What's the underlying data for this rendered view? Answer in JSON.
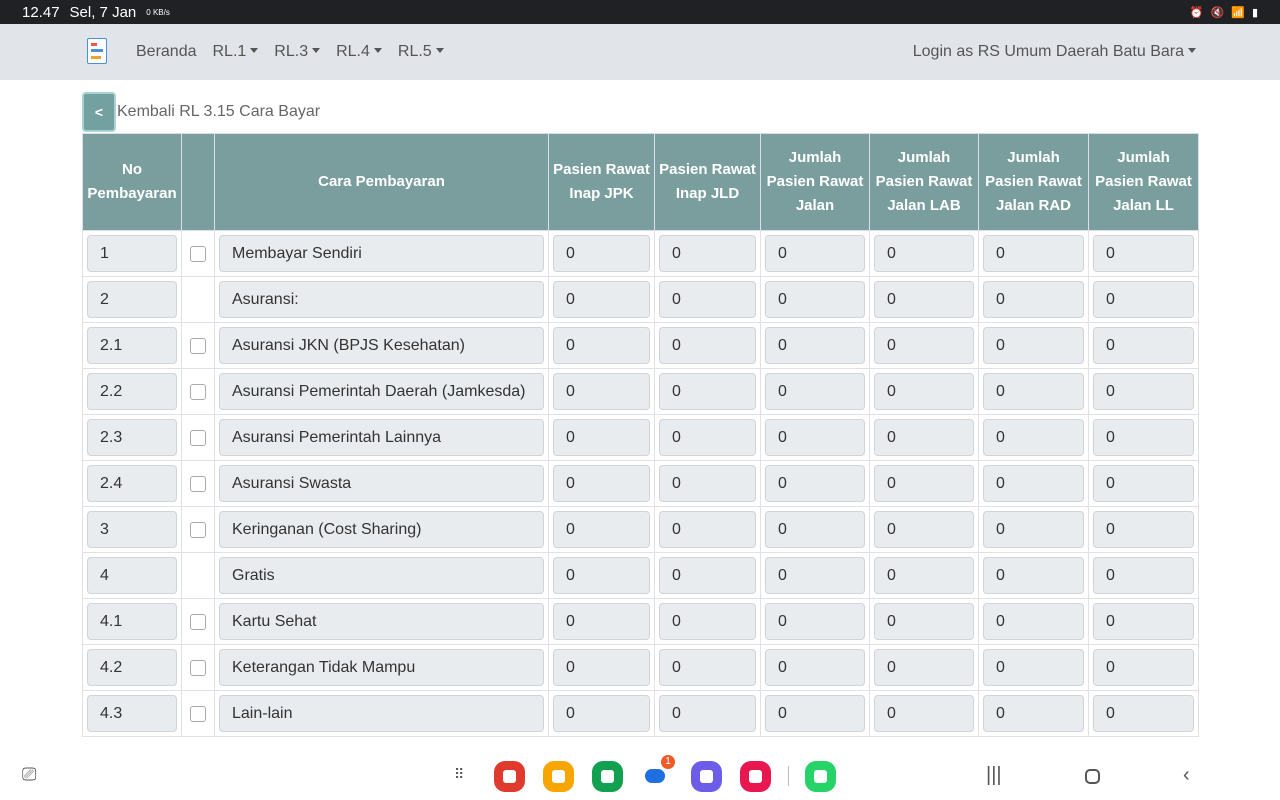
{
  "status": {
    "time": "12.47",
    "date": "Sel, 7 Jan",
    "net": "0 KB/s"
  },
  "nav": {
    "items": [
      {
        "label": "Beranda",
        "dropdown": false
      },
      {
        "label": "RL.1",
        "dropdown": true
      },
      {
        "label": "RL.3",
        "dropdown": true
      },
      {
        "label": "RL.4",
        "dropdown": true
      },
      {
        "label": "RL.5",
        "dropdown": true
      }
    ],
    "login": "Login as RS Umum Daerah Batu Bara"
  },
  "back": {
    "button": "<",
    "label": "Kembali RL 3.15 Cara Bayar"
  },
  "table": {
    "headers": [
      "No Pembayaran",
      "",
      "Cara Pembayaran",
      "Pasien Rawat Inap JPK",
      "Pasien Rawat Inap JLD",
      "Jumlah Pasien Rawat Jalan",
      "Jumlah Pasien Rawat Jalan LAB",
      "Jumlah Pasien Rawat Jalan RAD",
      "Jumlah Pasien Rawat Jalan LL"
    ],
    "rows": [
      {
        "no": "1",
        "checkbox": true,
        "cara": "Membayar Sendiri",
        "values": [
          "0",
          "0",
          "0",
          "0",
          "0",
          "0"
        ]
      },
      {
        "no": "2",
        "checkbox": false,
        "cara": "Asuransi:",
        "values": [
          "0",
          "0",
          "0",
          "0",
          "0",
          "0"
        ]
      },
      {
        "no": "2.1",
        "checkbox": true,
        "cara": "Asuransi JKN (BPJS Kesehatan)",
        "values": [
          "0",
          "0",
          "0",
          "0",
          "0",
          "0"
        ]
      },
      {
        "no": "2.2",
        "checkbox": true,
        "cara": "Asuransi Pemerintah Daerah (Jamkesda)",
        "values": [
          "0",
          "0",
          "0",
          "0",
          "0",
          "0"
        ]
      },
      {
        "no": "2.3",
        "checkbox": true,
        "cara": "Asuransi Pemerintah Lainnya",
        "values": [
          "0",
          "0",
          "0",
          "0",
          "0",
          "0"
        ]
      },
      {
        "no": "2.4",
        "checkbox": true,
        "cara": "Asuransi Swasta",
        "values": [
          "0",
          "0",
          "0",
          "0",
          "0",
          "0"
        ]
      },
      {
        "no": "3",
        "checkbox": true,
        "cara": "Keringanan (Cost Sharing)",
        "values": [
          "0",
          "0",
          "0",
          "0",
          "0",
          "0"
        ]
      },
      {
        "no": "4",
        "checkbox": false,
        "cara": "Gratis",
        "values": [
          "0",
          "0",
          "0",
          "0",
          "0",
          "0"
        ]
      },
      {
        "no": "4.1",
        "checkbox": true,
        "cara": "Kartu Sehat",
        "values": [
          "0",
          "0",
          "0",
          "0",
          "0",
          "0"
        ]
      },
      {
        "no": "4.2",
        "checkbox": true,
        "cara": "Keterangan Tidak Mampu",
        "values": [
          "0",
          "0",
          "0",
          "0",
          "0",
          "0"
        ]
      },
      {
        "no": "4.3",
        "checkbox": true,
        "cara": "Lain-lain",
        "values": [
          "0",
          "0",
          "0",
          "0",
          "0",
          "0"
        ]
      }
    ]
  },
  "dock": {
    "badge": "1",
    "apps": [
      {
        "name": "notes",
        "color": "#e03a2f"
      },
      {
        "name": "files",
        "color": "#f7a600"
      },
      {
        "name": "phone",
        "color": "#12a150"
      },
      {
        "name": "messages",
        "color": "#1e6fe0"
      },
      {
        "name": "internet",
        "color": "#6c5ce7"
      },
      {
        "name": "camera",
        "color": "#e8174f"
      },
      {
        "name": "whatsapp",
        "color": "#25d366"
      }
    ]
  }
}
